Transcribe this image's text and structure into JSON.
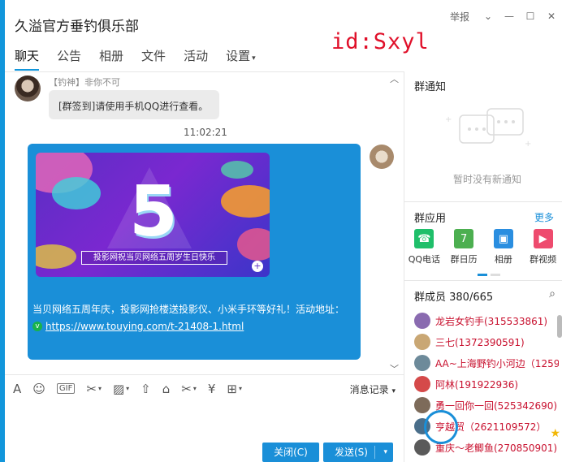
{
  "window": {
    "title": "久溢官方垂钓俱乐部",
    "id_tag": "id:Sxyl",
    "report": "举报",
    "controls": [
      "⌄",
      "—",
      "☐",
      "✕"
    ]
  },
  "tabs": [
    {
      "label": "聊天",
      "active": true
    },
    {
      "label": "公告",
      "active": false
    },
    {
      "label": "相册",
      "active": false
    },
    {
      "label": "文件",
      "active": false
    },
    {
      "label": "活动",
      "active": false
    },
    {
      "label": "设置",
      "active": false
    }
  ],
  "chat": {
    "msg1": {
      "sender": "【钓神】非你不可",
      "text": "[群签到]请使用手机QQ进行查看。"
    },
    "time": "11:02:21",
    "msg2": {
      "banner_number": "5",
      "banner_caption": "投影网祝当贝网络五周岁生日快乐",
      "text": "当贝网络五周年庆，投影网抢楼送投影仪、小米手环等好礼！活动地址：",
      "url": "https://www.touying.com/t-21408-1.html"
    }
  },
  "toolbar": {
    "icons": [
      "font-icon",
      "emoji-icon",
      "gif-icon",
      "screenshot-icon",
      "image-icon",
      "upload-icon",
      "gift-icon",
      "scissors-icon",
      "red-packet-icon",
      "more-icon"
    ],
    "history": "消息记录"
  },
  "buttons": {
    "close": "关闭(C)",
    "send": "发送(S)"
  },
  "right": {
    "notice_title": "群通知",
    "notice_empty": "暂时没有新通知",
    "apps_title": "群应用",
    "apps_more": "更多",
    "apps": [
      {
        "label": "QQ电话",
        "color": "#1fbf6a",
        "glyph": "☎"
      },
      {
        "label": "群日历",
        "color": "#4caf50",
        "glyph": "7"
      },
      {
        "label": "相册",
        "color": "#2a8ee0",
        "glyph": "▣"
      },
      {
        "label": "群视频",
        "color": "#ee4b6e",
        "glyph": "▶"
      }
    ],
    "members_title": "群成员 380/665",
    "members": [
      {
        "name": "龙岩女钓手(315533861)",
        "color": "#8a6bb0"
      },
      {
        "name": "三七(1372390591)",
        "color": "#c9a774"
      },
      {
        "name": "AA~上海野钓小河边（1259",
        "color": "#6d8a9a"
      },
      {
        "name": "阿林(191922936)",
        "color": "#d54a4a"
      },
      {
        "name": "勇一回你一回(525342690)",
        "color": "#7d6b5a"
      },
      {
        "name": "亨越贸（2621109572）",
        "color": "#4a6e8a"
      },
      {
        "name": "重庆～老鲫鱼(270850901)",
        "color": "#5a5a5a"
      }
    ]
  }
}
